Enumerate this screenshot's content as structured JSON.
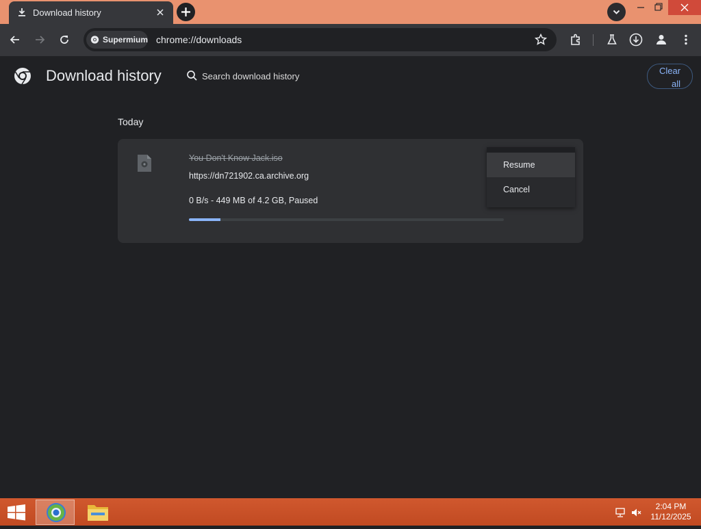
{
  "tab": {
    "title": "Download history",
    "icon": "download-icon"
  },
  "toolbar": {
    "chip_label": "Supermium",
    "url": "chrome://downloads"
  },
  "page": {
    "title": "Download history",
    "search_placeholder": "Search download history",
    "clear_all_line1": "Clear",
    "clear_all_line2": "all",
    "section_label": "Today"
  },
  "download": {
    "file_name": "You Don't Know Jack.iso",
    "url": "https://dn721902.ca.archive.org",
    "status": "0 B/s - 449 MB of 4.2 GB, Paused",
    "progress_fraction": 0.1
  },
  "menu": {
    "items": [
      {
        "label": "Resume"
      },
      {
        "label": "Cancel"
      }
    ]
  },
  "taskbar": {
    "time": "2:04 PM",
    "date": "11/12/2025",
    "apps": [
      "supermium-app-icon",
      "file-explorer-icon"
    ]
  },
  "colors": {
    "titlebar": "#e9926f",
    "page_bg": "#202124",
    "accent": "#8ab4f8",
    "taskbar": "#c94f27"
  }
}
